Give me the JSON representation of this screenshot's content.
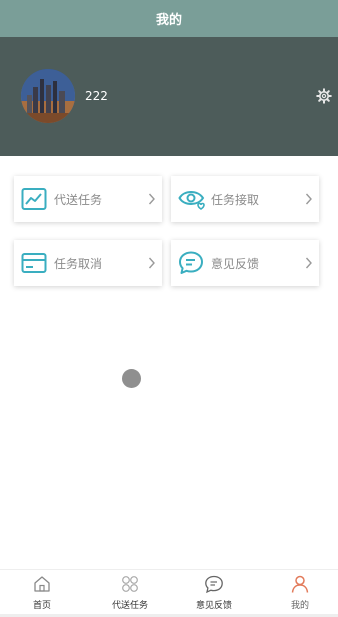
{
  "header": {
    "title": "我的"
  },
  "profile": {
    "username": "222",
    "settings_icon": "gear-icon"
  },
  "menu": [
    {
      "label": "代送任务",
      "icon": "chart-line-icon"
    },
    {
      "label": "任务接取",
      "icon": "eye-heart-icon"
    },
    {
      "label": "任务取消",
      "icon": "card-icon"
    },
    {
      "label": "意见反馈",
      "icon": "chat-bubble-icon"
    }
  ],
  "tabbar": [
    {
      "label": "首页",
      "icon": "home-icon"
    },
    {
      "label": "代送任务",
      "icon": "grid-icon"
    },
    {
      "label": "意见反馈",
      "icon": "chat-icon"
    },
    {
      "label": "我的",
      "icon": "user-icon",
      "active": true
    }
  ],
  "colors": {
    "header": "#7a9e98",
    "profile_bg": "#4d5c5a",
    "accent": "#3aaec0",
    "active_tab": "#e27a5a"
  }
}
